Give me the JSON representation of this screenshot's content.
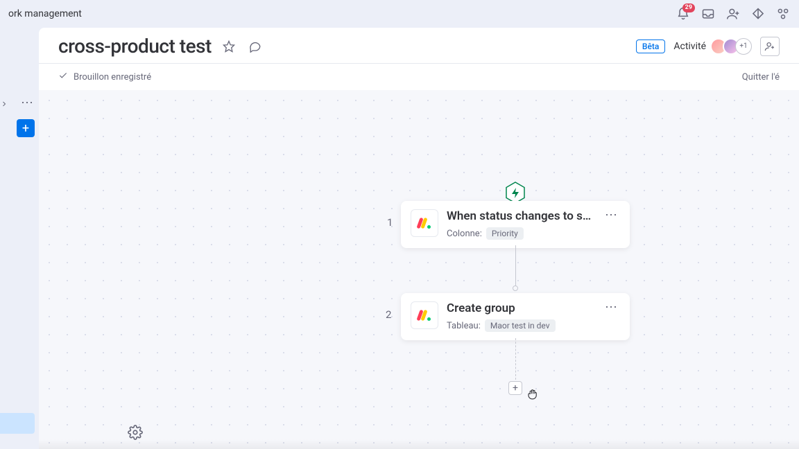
{
  "topbar": {
    "breadcrumb_fragment": "ork management",
    "notification_count": "29"
  },
  "header": {
    "title": "cross-product test",
    "beta_label": "Bêta",
    "activity_label": "Activité",
    "avatar_more": "+1"
  },
  "subheader": {
    "status": "Brouillon enregistré",
    "quit_label": "Quitter l'é"
  },
  "steps": {
    "one": {
      "number": "1",
      "title": "When status changes to so…",
      "meta_label": "Colonne:",
      "meta_value": "Priority"
    },
    "two": {
      "number": "2",
      "title": "Create group",
      "meta_label": "Tableau:",
      "meta_value": "Maor test in dev"
    }
  }
}
